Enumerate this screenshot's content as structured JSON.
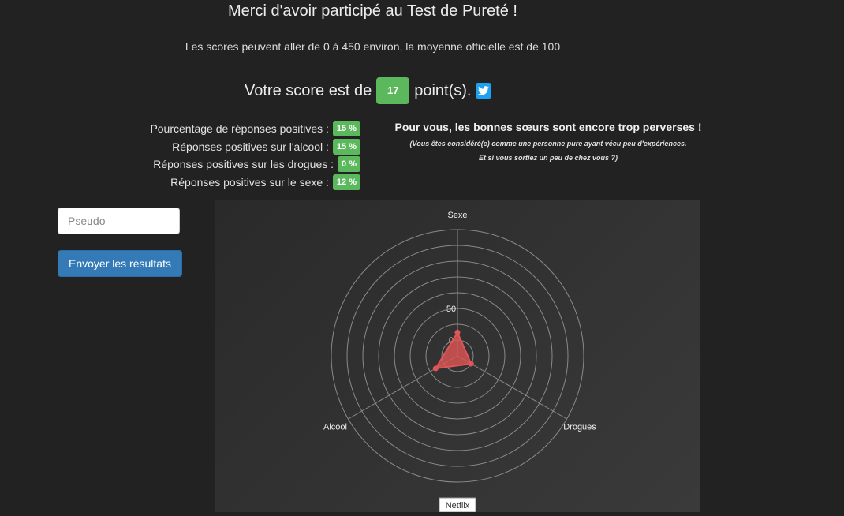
{
  "header": {
    "title": "Merci d'avoir participé au Test de Pureté !",
    "subtitle": "Les scores peuvent aller de 0 à 450 environ, la moyenne officielle est de 100"
  },
  "score": {
    "prefix": "Votre score est de",
    "value": "17",
    "suffix": "point(s).",
    "share_icon": "twitter-icon"
  },
  "stats": [
    {
      "label": "Pourcentage de réponses positives :",
      "value": "15 %"
    },
    {
      "label": "Réponses positives sur l'alcool :",
      "value": "15 %"
    },
    {
      "label": "Réponses positives sur les drogues :",
      "value": "0 %"
    },
    {
      "label": "Réponses positives sur le sexe :",
      "value": "12 %"
    }
  ],
  "verdict": {
    "title": "Pour vous, les bonnes sœurs sont encore trop perverses !",
    "line1": "(Vous êtes considéré(e) comme une personne pure ayant vécu peu d'expériences.",
    "line2": "Et si vous sortiez un peu de chez vous ?)"
  },
  "form": {
    "pseudo_placeholder": "Pseudo",
    "pseudo_value": "",
    "send_label": "Envoyer les résultats"
  },
  "chart_data": {
    "type": "radar",
    "categories": [
      "Sexe",
      "Drogues",
      "Alcool"
    ],
    "series": [
      {
        "values": [
          12,
          0,
          15
        ]
      }
    ],
    "r_ticks": [
      "0",
      "50"
    ],
    "r_range": [
      -25,
      175
    ],
    "tooltip": "Netflix",
    "colors": {
      "series": "#e05555",
      "grid": "#8a8a8a",
      "background": "#333333"
    }
  }
}
